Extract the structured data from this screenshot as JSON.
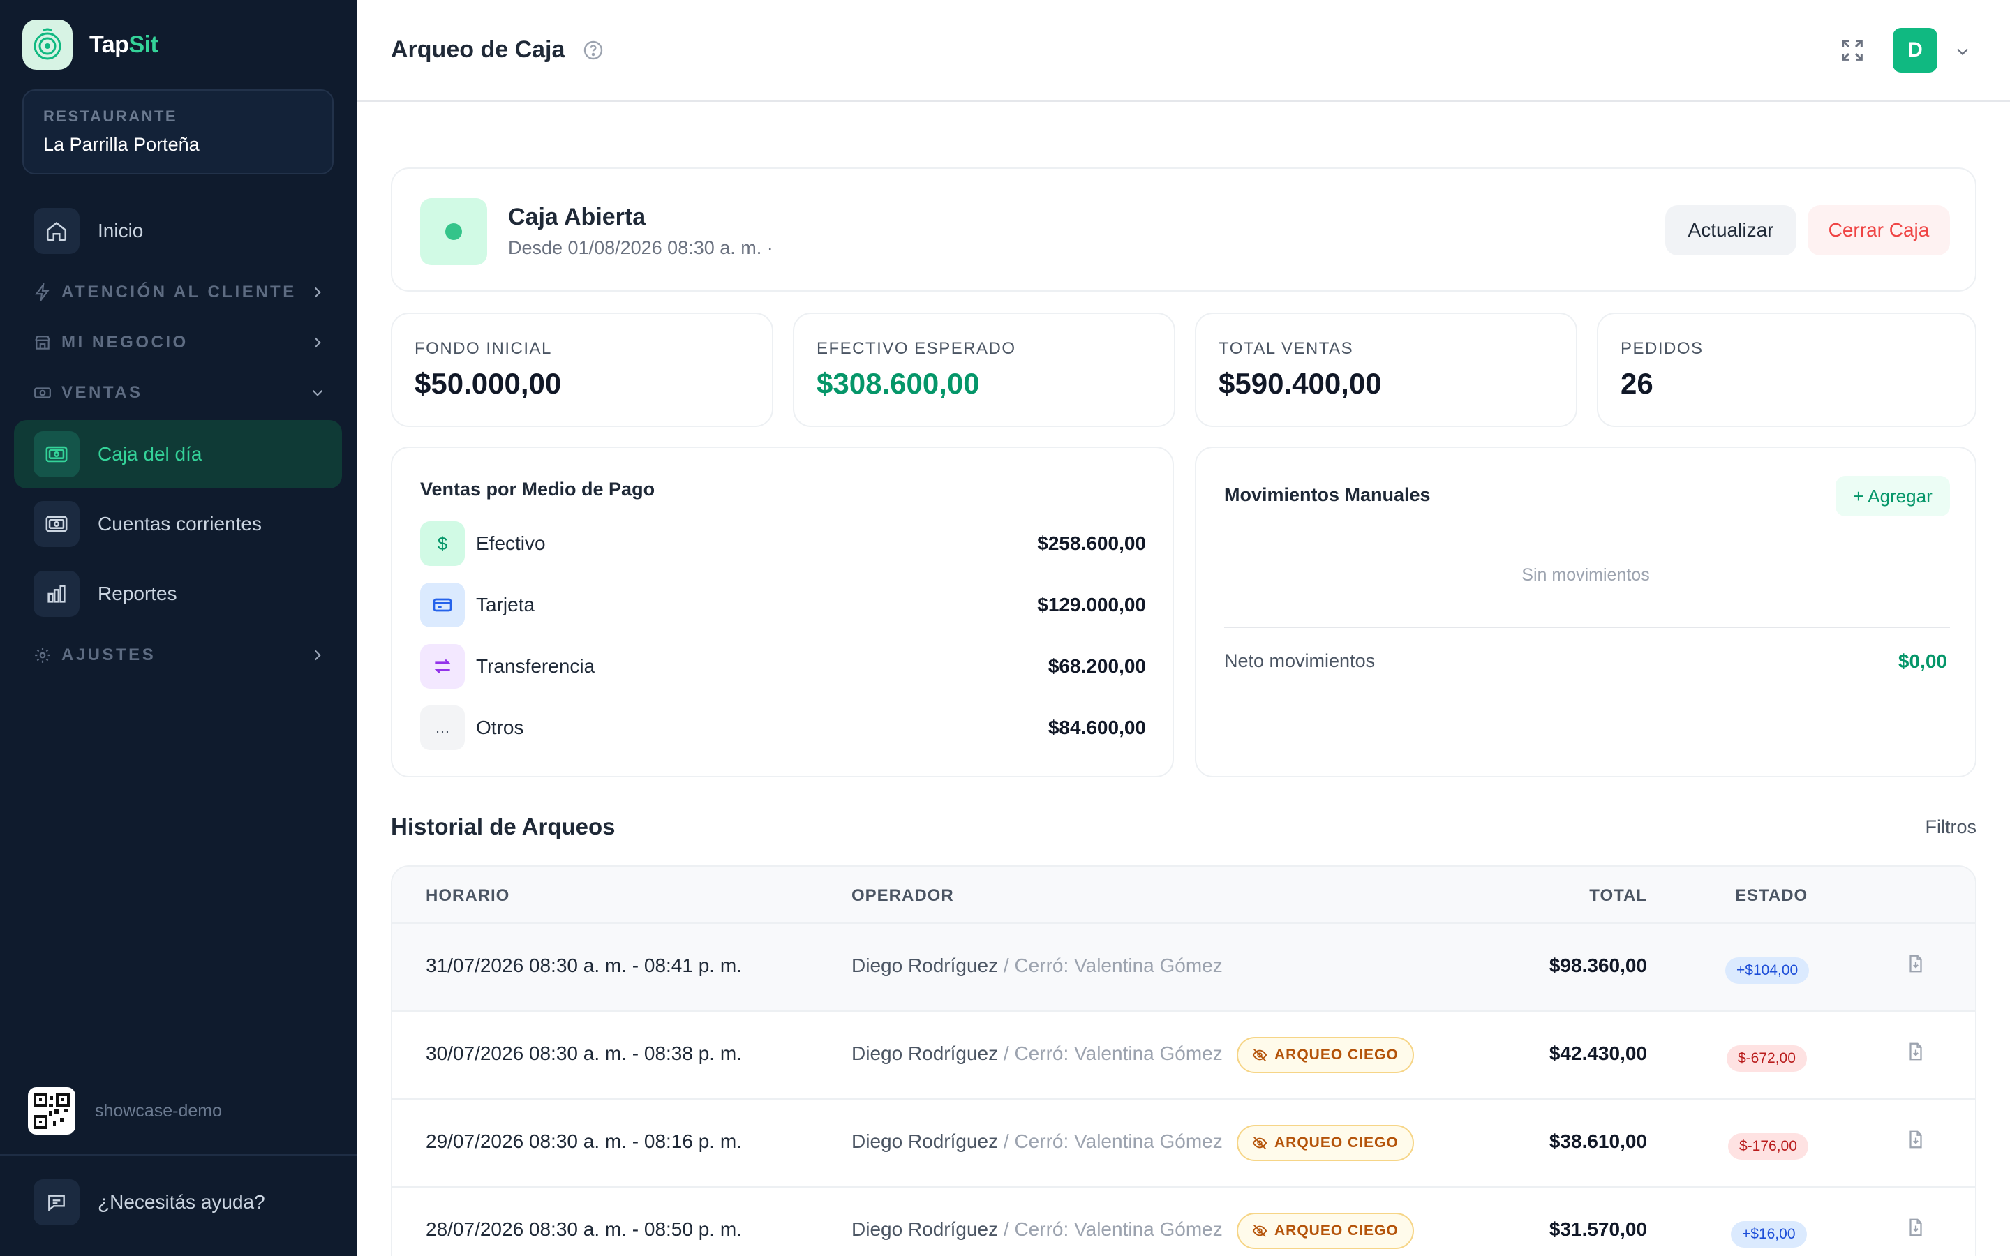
{
  "brand": {
    "name_part1": "Tap",
    "name_part2": "Sit"
  },
  "restaurant": {
    "label": "RESTAURANTE",
    "name": "La Parrilla Porteña"
  },
  "nav": {
    "home": "Inicio",
    "section_attention": "ATENCIÓN AL CLIENTE",
    "section_business": "MI NEGOCIO",
    "section_sales": "VENTAS",
    "cash_day": "Caja del día",
    "accounts": "Cuentas corrientes",
    "reports": "Reportes",
    "section_settings": "AJUSTES"
  },
  "sidebar_footer": {
    "demo": "showcase-demo",
    "help": "¿Necesitás ayuda?"
  },
  "header": {
    "title": "Arqueo de Caja",
    "avatar_initial": "D"
  },
  "status": {
    "title": "Caja Abierta",
    "subtitle": "Desde 01/08/2026 08:30 a. m. ·",
    "update_label": "Actualizar",
    "close_label": "Cerrar Caja"
  },
  "stats": [
    {
      "label": "FONDO INICIAL",
      "value": "$50.000,00"
    },
    {
      "label": "EFECTIVO ESPERADO",
      "value": "$308.600,00"
    },
    {
      "label": "TOTAL VENTAS",
      "value": "$590.400,00"
    },
    {
      "label": "PEDIDOS",
      "value": "26"
    }
  ],
  "payments": {
    "title": "Ventas por Medio de Pago",
    "items": [
      {
        "label": "Efectivo",
        "amount": "$258.600,00",
        "icon": "dollar-icon"
      },
      {
        "label": "Tarjeta",
        "amount": "$129.000,00",
        "icon": "credit-card-icon"
      },
      {
        "label": "Transferencia",
        "amount": "$68.200,00",
        "icon": "transfer-icon"
      },
      {
        "label": "Otros",
        "amount": "$84.600,00",
        "icon": "ellipsis-icon"
      }
    ]
  },
  "movements": {
    "title": "Movimientos Manuales",
    "add_label": "+ Agregar",
    "empty": "Sin movimientos",
    "net_label": "Neto movimientos",
    "net_value": "$0,00"
  },
  "history": {
    "title": "Historial de Arqueos",
    "filters_label": "Filtros",
    "columns": {
      "time": "HORARIO",
      "operator": "OPERADOR",
      "total": "TOTAL",
      "status": "ESTADO"
    },
    "blind_label": "ARQUEO CIEGO",
    "rows": [
      {
        "time": "31/07/2026 08:30 a. m. - 08:41 p. m.",
        "operator": "Diego Rodríguez",
        "closed_by": "/ Cerró: Valentina Gómez",
        "blind": false,
        "total": "$98.360,00",
        "diff": "+$104,00",
        "diff_type": "pos"
      },
      {
        "time": "30/07/2026 08:30 a. m. - 08:38 p. m.",
        "operator": "Diego Rodríguez",
        "closed_by": "/ Cerró: Valentina Gómez",
        "blind": true,
        "total": "$42.430,00",
        "diff": "$-672,00",
        "diff_type": "neg"
      },
      {
        "time": "29/07/2026 08:30 a. m. - 08:16 p. m.",
        "operator": "Diego Rodríguez",
        "closed_by": "/ Cerró: Valentina Gómez",
        "blind": true,
        "total": "$38.610,00",
        "diff": "$-176,00",
        "diff_type": "neg"
      },
      {
        "time": "28/07/2026 08:30 a. m. - 08:50 p. m.",
        "operator": "Diego Rodríguez",
        "closed_by": "/ Cerró: Valentina Gómez",
        "blind": true,
        "total": "$31.570,00",
        "diff": "+$16,00",
        "diff_type": "pos"
      }
    ]
  },
  "colors": {
    "accent": "#34d399",
    "sidebar_bg": "#0f1b2d",
    "danger": "#ef4444",
    "success": "#059669"
  }
}
